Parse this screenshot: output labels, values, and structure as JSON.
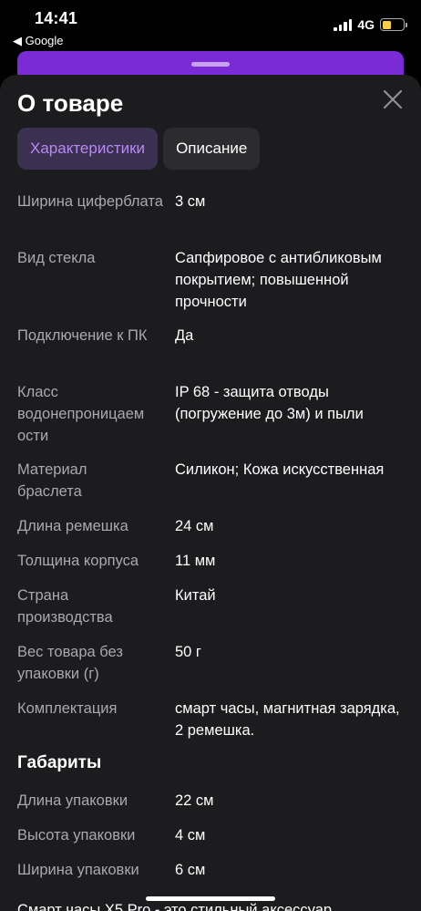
{
  "status": {
    "time": "14:41",
    "back_app": "◀ Google",
    "network": "4G"
  },
  "sheet": {
    "title": "О товаре",
    "tabs": [
      {
        "label": "Характеристики",
        "active": true
      },
      {
        "label": "Описание",
        "active": false
      }
    ]
  },
  "specs": [
    {
      "label": "Ширина циферблата",
      "value": "3 см"
    },
    {
      "label": "Вид стекла",
      "value": "Сапфировое с антибликовым покрытием; повышенной прочности"
    },
    {
      "label": "Подключение к ПК",
      "value": "Да"
    },
    {
      "label": "Класс водонепроницаем ости",
      "value": "IP 68 - защита отводы (погружение до 3м) и пыли"
    },
    {
      "label": "Материал браслета",
      "value": "Силикон; Кожа искусственная"
    },
    {
      "label": "Длина ремешка",
      "value": "24 см"
    },
    {
      "label": "Толщина корпуса",
      "value": "11 мм"
    },
    {
      "label": "Страна производства",
      "value": "Китай"
    },
    {
      "label": "Вес товара без упаковки (г)",
      "value": "50 г"
    },
    {
      "label": "Комплектация",
      "value": "смарт часы, магнитная зарядка, 2 ремешка."
    }
  ],
  "dimensions": {
    "title": "Габариты",
    "items": [
      {
        "label": "Длина упаковки",
        "value": "22 см"
      },
      {
        "label": "Высота упаковки",
        "value": "4 см"
      },
      {
        "label": "Ширина упаковки",
        "value": "6 см"
      }
    ]
  },
  "footer_text": "Смарт часы X5 Pro - это стильный аксессуар",
  "colors": {
    "accent": "#b889f5",
    "sheet_bg": "#1c1c1e",
    "behind_card": "#7b2bd6"
  }
}
